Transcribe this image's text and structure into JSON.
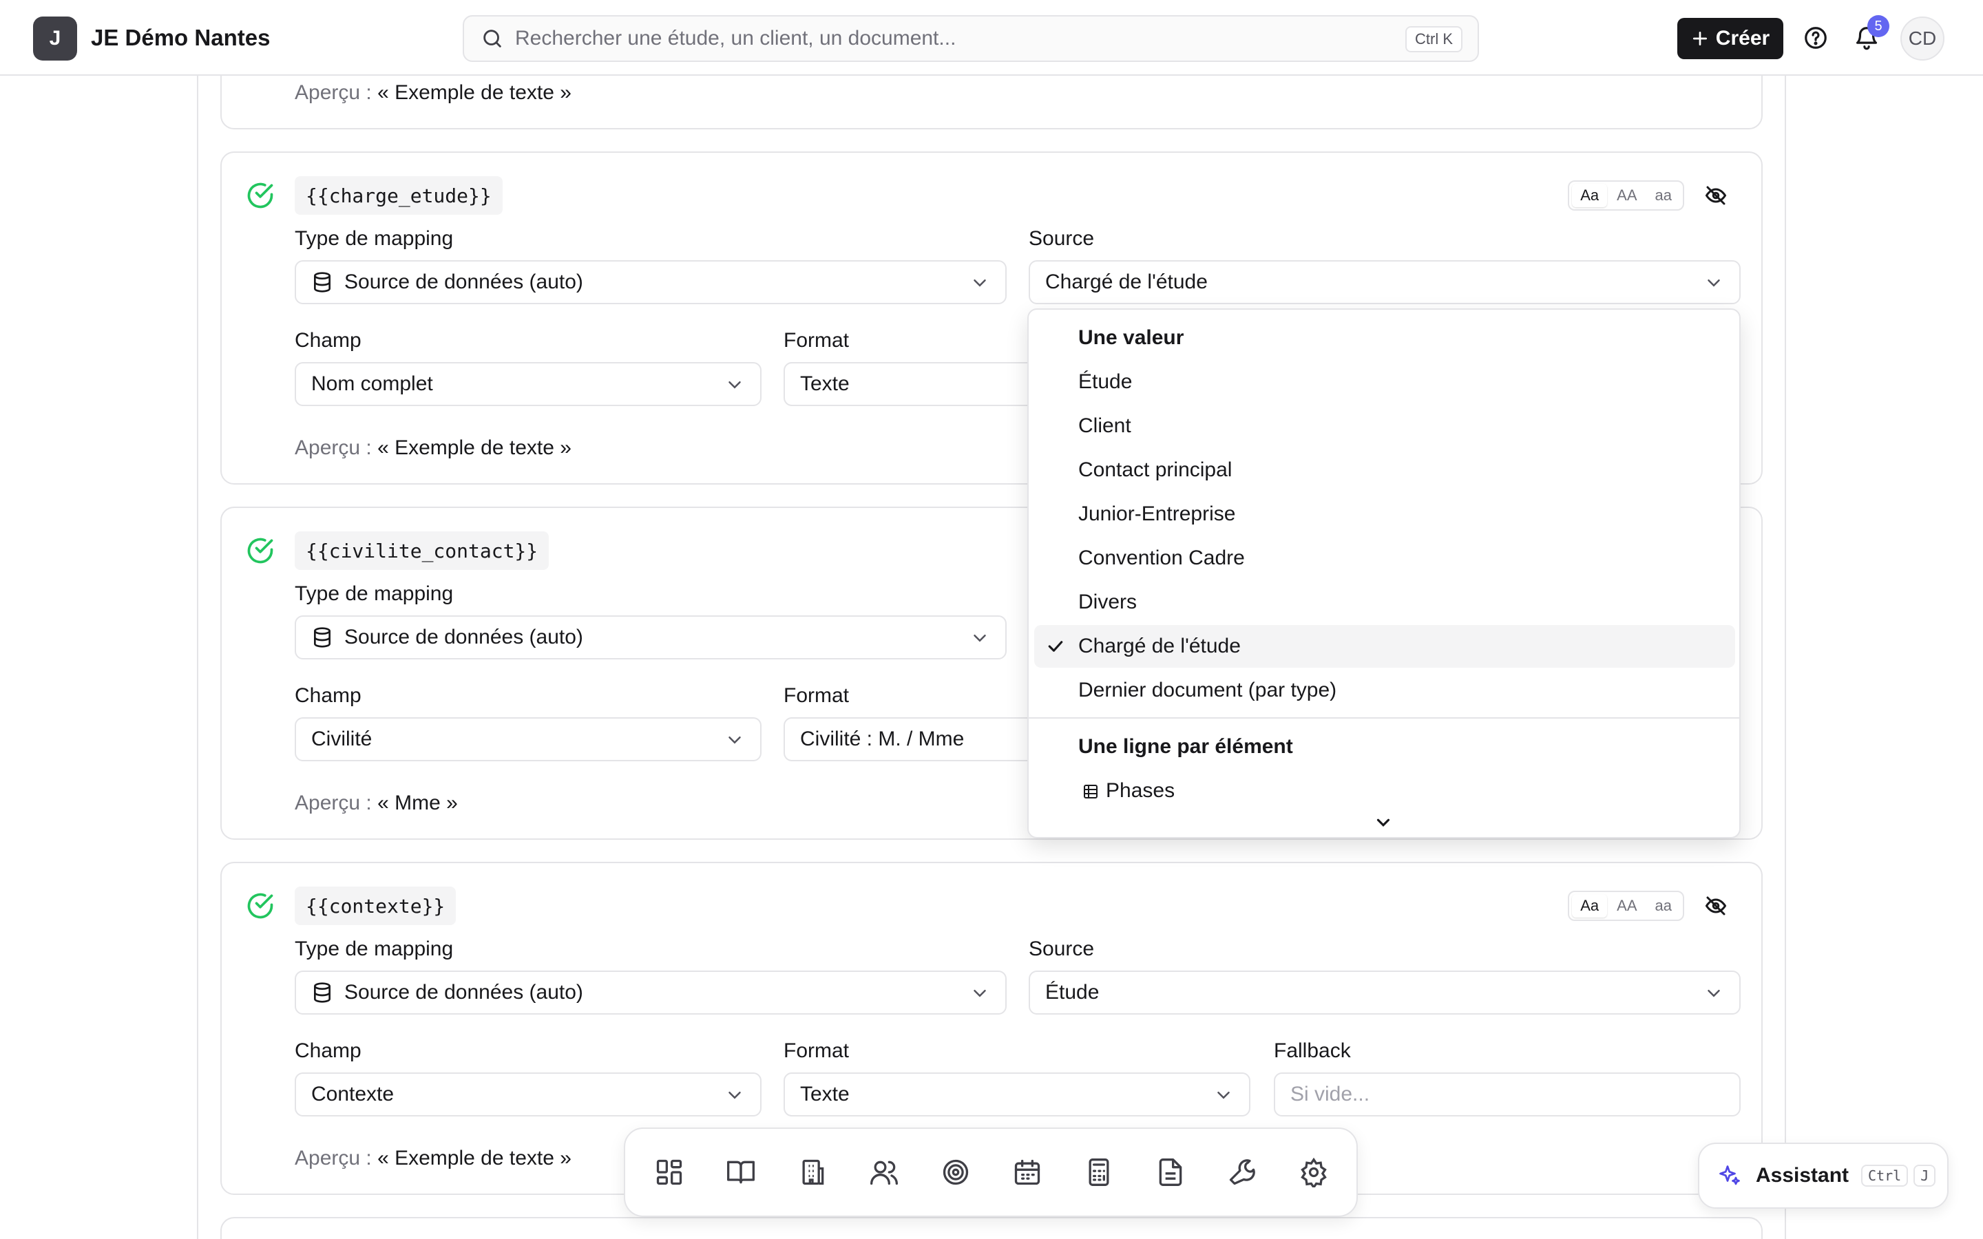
{
  "header": {
    "logo_letter": "J",
    "org_name": "JE Démo Nantes",
    "search_placeholder": "Rechercher une étude, un client, un document...",
    "search_shortcut": "Ctrl K",
    "create_label": "Créer",
    "notifications_count": "5",
    "avatar_initials": "CD"
  },
  "labels": {
    "type_mapping": "Type de mapping",
    "source": "Source",
    "champ": "Champ",
    "format": "Format",
    "fallback": "Fallback",
    "preview_prefix": "Aperçu :",
    "case_options": [
      "Aa",
      "AA",
      "aa"
    ]
  },
  "cards": [
    {
      "preview_value": "« Exemple de texte »"
    },
    {
      "placeholder": "{{charge_etude}}",
      "mapping_type": "Source de données (auto)",
      "source": "Chargé de l'étude",
      "champ": "Nom complet",
      "format": "Texte",
      "preview_value": "« Exemple de texte »"
    },
    {
      "placeholder": "{{civilite_contact}}",
      "mapping_type": "Source de données (auto)",
      "champ": "Civilité",
      "format": "Civilité : M. / Mme",
      "preview_value": "« Mme »"
    },
    {
      "placeholder": "{{contexte}}",
      "mapping_type": "Source de données (auto)",
      "source": "Étude",
      "champ": "Contexte",
      "format": "Texte",
      "fallback_placeholder": "Si vide...",
      "preview_value": "« Exemple de texte »"
    }
  ],
  "source_dropdown": {
    "group_single": "Une valeur",
    "items": [
      "Étude",
      "Client",
      "Contact principal",
      "Junior-Entreprise",
      "Convention Cadre",
      "Divers",
      "Chargé de l'étude",
      "Dernier document (par type)"
    ],
    "selected": "Chargé de l'étude",
    "group_multi": "Une ligne par élément",
    "multi_items": [
      "Phases"
    ]
  },
  "dock": {
    "icons": [
      "dashboard-icon",
      "book-icon",
      "building-icon",
      "users-icon",
      "target-icon",
      "calendar-icon",
      "calculator-icon",
      "document-icon",
      "wrench-icon",
      "settings-icon"
    ]
  },
  "assistant": {
    "label": "Assistant",
    "shortcut_1": "Ctrl",
    "shortcut_2": "J"
  },
  "colors": {
    "success": "#22c55e",
    "badge": "#6366f1",
    "dark": "#18181b",
    "border": "#e4e4e7"
  }
}
